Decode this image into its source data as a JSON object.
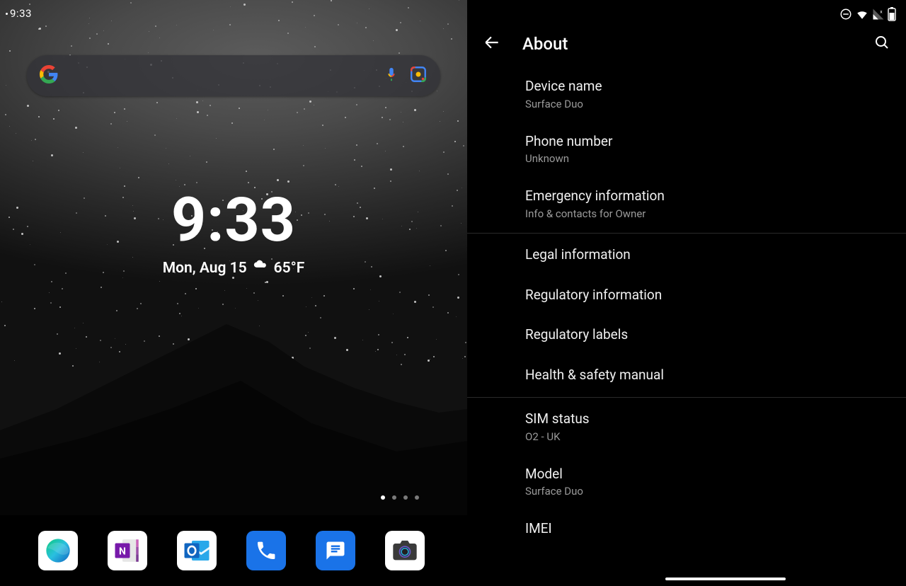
{
  "status_bar": {
    "time": "9:33"
  },
  "home": {
    "clock": {
      "time": "9:33",
      "date": "Mon, Aug 15",
      "temp": "65°F"
    },
    "page_indicator": {
      "count": 4,
      "active": 0
    },
    "dock": [
      {
        "name": "edge-app-icon",
        "label": "Edge"
      },
      {
        "name": "onenote-app-icon",
        "label": "OneNote"
      },
      {
        "name": "outlook-app-icon",
        "label": "Outlook"
      },
      {
        "name": "phone-app-icon",
        "label": "Phone"
      },
      {
        "name": "messages-app-icon",
        "label": "Messages"
      },
      {
        "name": "camera-app-icon",
        "label": "Camera"
      }
    ]
  },
  "settings": {
    "title": "About",
    "items": [
      {
        "title": "Device name",
        "subtitle": "Surface Duo"
      },
      {
        "title": "Phone number",
        "subtitle": "Unknown"
      },
      {
        "title": "Emergency information",
        "subtitle": "Info & contacts for Owner"
      },
      {
        "divider": true
      },
      {
        "title": "Legal information"
      },
      {
        "title": "Regulatory information"
      },
      {
        "title": "Regulatory labels"
      },
      {
        "title": "Health & safety manual"
      },
      {
        "divider": true
      },
      {
        "title": "SIM status",
        "subtitle": "O2 - UK"
      },
      {
        "title": "Model",
        "subtitle": "Surface Duo"
      },
      {
        "title": "IMEI"
      }
    ]
  }
}
